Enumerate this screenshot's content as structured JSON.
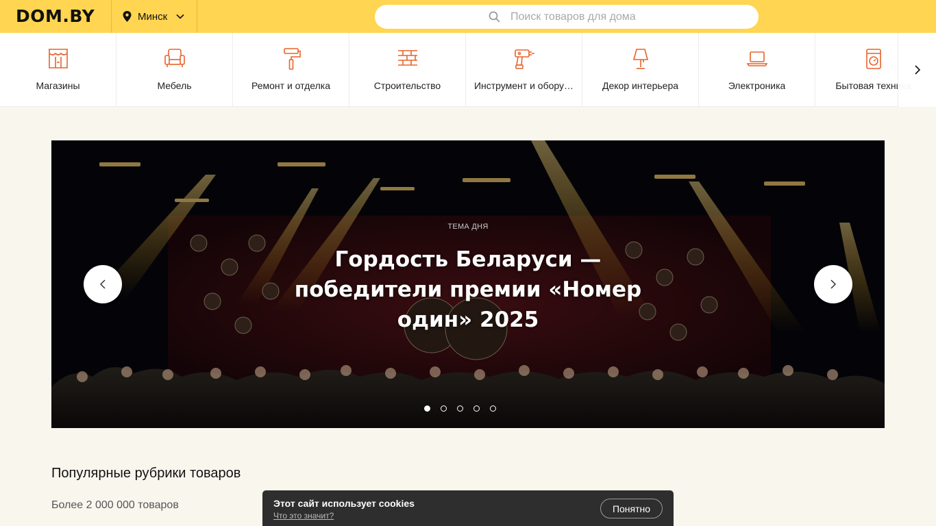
{
  "header": {
    "logo": "DOM.BY",
    "city": "Минск",
    "search_placeholder": "Поиск товаров для дома"
  },
  "categories": [
    {
      "label": "Магазины",
      "icon": "storefront-icon"
    },
    {
      "label": "Мебель",
      "icon": "armchair-icon"
    },
    {
      "label": "Ремонт и отделка",
      "icon": "paint-roller-icon"
    },
    {
      "label": "Строительство",
      "icon": "brick-wall-icon"
    },
    {
      "label": "Инструмент и обору…",
      "icon": "drill-icon"
    },
    {
      "label": "Декор интерьера",
      "icon": "lamp-icon"
    },
    {
      "label": "Электроника",
      "icon": "laptop-icon"
    },
    {
      "label": "Бытовая техника",
      "icon": "washing-machine-icon"
    }
  ],
  "banner": {
    "kicker": "ТЕМА ДНЯ",
    "headline": "Гордость Беларуси — победители премии «Номер один» 2025",
    "slides_count": 5,
    "active_slide": 1
  },
  "section": {
    "title": "Популярные рубрики товаров",
    "subtitle": "Более 2 000 000 товаров"
  },
  "cookie": {
    "title": "Этот сайт использует cookies",
    "link": "Что это значит?",
    "button": "Понятно"
  },
  "colors": {
    "header_bg": "#ffd551",
    "icon_accent": "#e8622a",
    "page_bg": "#f9f6ee",
    "cookie_bg": "#2e2e2e"
  }
}
